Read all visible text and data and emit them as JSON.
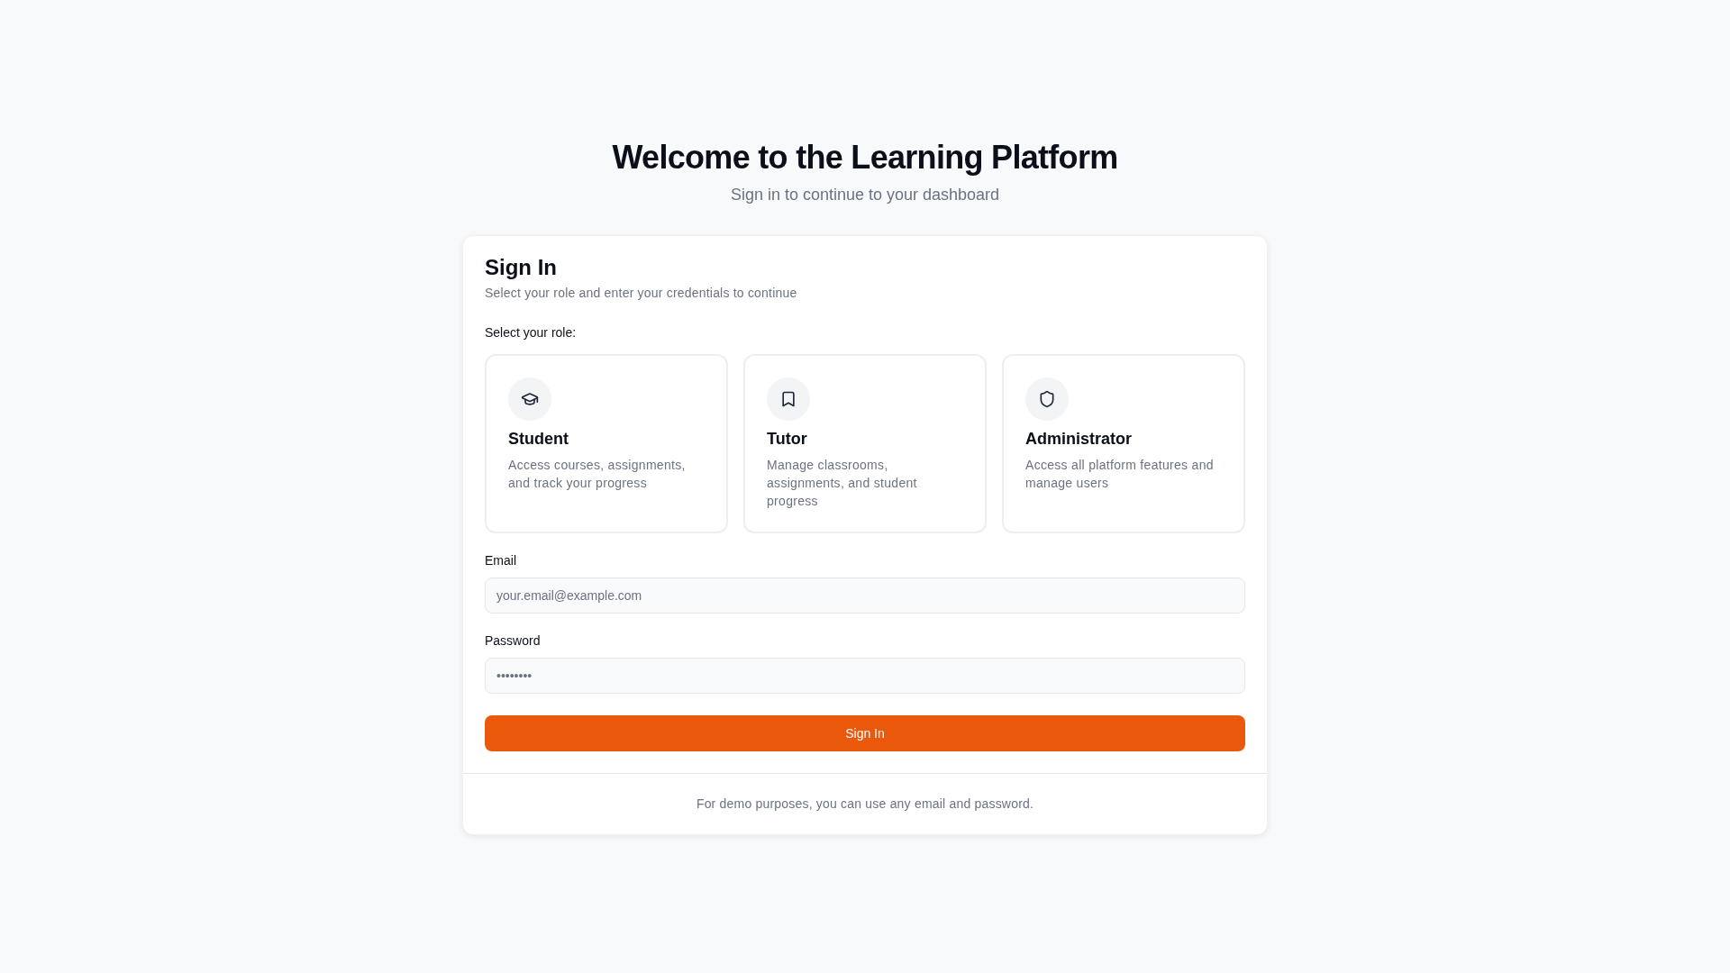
{
  "header": {
    "title": "Welcome to the Learning Platform",
    "subtitle": "Sign in to continue to your dashboard"
  },
  "sign_in_card": {
    "title": "Sign In",
    "description": "Select your role and enter your credentials to continue",
    "role_label": "Select your role:",
    "roles": [
      {
        "kind": "student",
        "name": "Student",
        "description": "Access courses, assignments, and track your progress",
        "selected": false
      },
      {
        "kind": "tutor",
        "name": "Tutor",
        "description": "Manage classrooms, assignments, and student progress",
        "selected": false
      },
      {
        "kind": "administrator",
        "name": "Administrator",
        "description": "Access all platform features and manage users",
        "selected": false
      }
    ],
    "fields": [
      {
        "label": "Email",
        "placeholder": "your.email@example.com"
      },
      {
        "label": "Password",
        "placeholder": "••••••••"
      }
    ],
    "submit_button": "Sign In",
    "footer_note": "For demo purposes, you can use any email and password."
  }
}
